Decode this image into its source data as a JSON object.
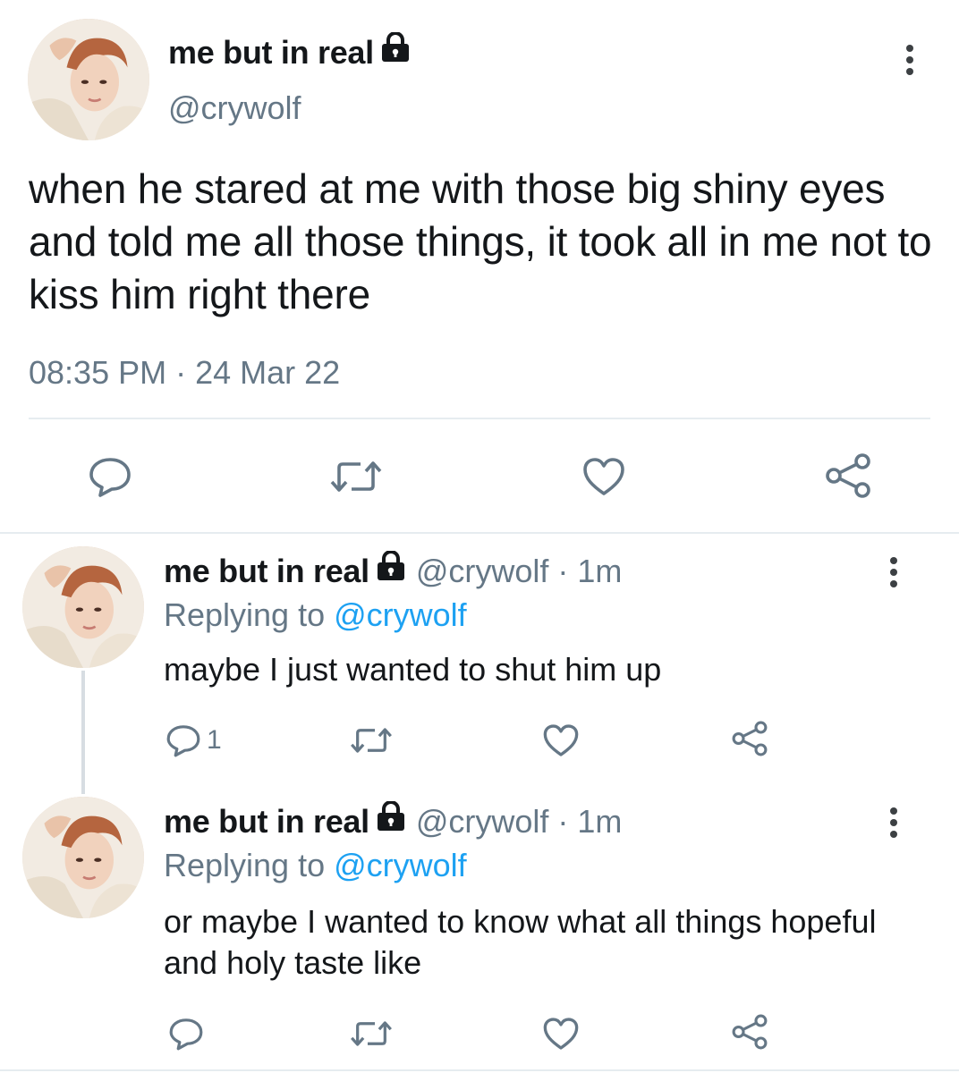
{
  "main_tweet": {
    "display_name": "me but in real",
    "handle": "@crywolf",
    "text": "when he stared at me with those big shiny eyes and told me all those things, it took all in me not to kiss him right there",
    "timestamp": "08:35 PM · 24 Mar 22",
    "actions": [
      "comment-icon",
      "retweet-icon",
      "like-icon",
      "share-icon"
    ]
  },
  "replies": [
    {
      "display_name": "me but in real",
      "handle_time": "@crywolf · 1m",
      "replying_prefix": "Replying to ",
      "replying_to": "@crywolf",
      "text": "maybe I just wanted to shut him up",
      "reply_count": "1"
    },
    {
      "display_name": "me but in real",
      "handle_time": "@crywolf · 1m",
      "replying_prefix": "Replying to ",
      "replying_to": "@crywolf",
      "text": "or maybe I wanted to know what all things hopeful and holy taste like",
      "reply_count": ""
    }
  ],
  "colors": {
    "text": "#14171a",
    "secondary": "#657786",
    "link": "#1da1f2",
    "divider": "#e6ecf0"
  }
}
